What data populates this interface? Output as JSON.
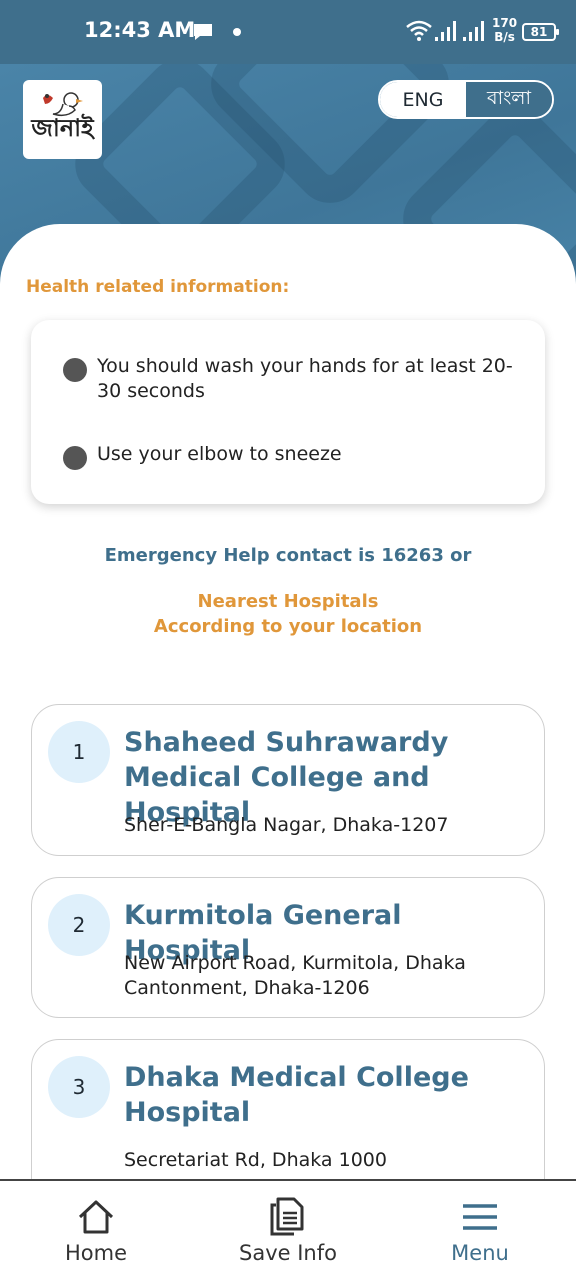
{
  "status_bar": {
    "time": "12:43 AM",
    "speed_value": "170",
    "speed_unit": "B/s",
    "battery": "81",
    "icons": [
      "chat-bubble-icon",
      "notification-dot-icon",
      "wifi-icon",
      "signal-icon",
      "signal-icon",
      "battery-icon"
    ]
  },
  "header": {
    "logo_text": "জানাই",
    "language": {
      "options": [
        "ENG",
        "বাংলা"
      ],
      "selected": "ENG"
    }
  },
  "health": {
    "title": "Health related information:",
    "tips": [
      "You should wash your hands for at least 20-30 seconds",
      "Use your elbow to sneeze"
    ]
  },
  "emergency_text": "Emergency Help contact is 16263 or",
  "nearest": {
    "line1": "Nearest Hospitals",
    "line2": "According to your location"
  },
  "hospitals": [
    {
      "number": "1",
      "name": "Shaheed Suhrawardy Medical College and Hospital",
      "address": "Sher-E-Bangla Nagar, Dhaka-1207"
    },
    {
      "number": "2",
      "name": "Kurmitola General Hospital",
      "address": "New Airport Road, Kurmitola, Dhaka Cantonment, Dhaka-1206"
    },
    {
      "number": "3",
      "name": "Dhaka Medical College Hospital",
      "address": "Secretariat Rd, Dhaka 1000"
    }
  ],
  "bottom_nav": {
    "items": [
      {
        "label": "Home",
        "icon": "home-icon"
      },
      {
        "label": "Save Info",
        "icon": "document-icon"
      },
      {
        "label": "Menu",
        "icon": "menu-icon"
      }
    ],
    "active": "Menu"
  },
  "colors": {
    "primary": "#3f6f8c",
    "accent": "#e0973a",
    "number_bg": "#dff0fb"
  }
}
